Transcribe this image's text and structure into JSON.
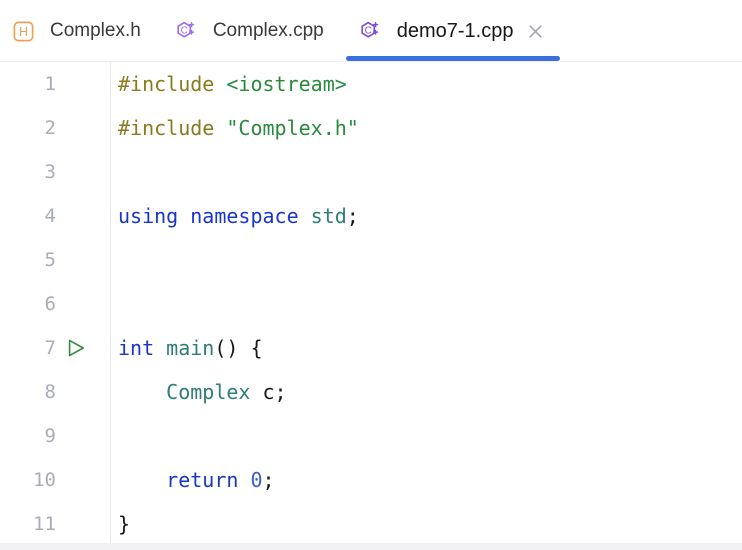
{
  "window": {
    "background_color": "#ffffff"
  },
  "tabbar": {
    "tabs": [
      {
        "label": "Complex.h",
        "icon": "cpp-header-file-icon",
        "icon_color": "#e8a25a",
        "active": false,
        "closable": false
      },
      {
        "label": "Complex.cpp",
        "icon": "cpp-source-file-icon",
        "icon_color": "#9b72e8",
        "active": false,
        "closable": false
      },
      {
        "label": "demo7-1.cpp",
        "icon": "cpp-source-file-icon",
        "icon_color": "#7b4de0",
        "active": true,
        "closable": true,
        "close_label": "×",
        "underline_color": "#3b6fe0"
      }
    ]
  },
  "editor": {
    "gutter": {
      "line_numbers": [
        "1",
        "2",
        "3",
        "4",
        "5",
        "6",
        "7",
        "8",
        "9",
        "10",
        "11"
      ],
      "run_marker": {
        "on_line": "7",
        "icon": "run-play-icon",
        "color": "#3f8a3f"
      }
    },
    "lines": [
      {
        "number": "1",
        "tokens": [
          {
            "text": "#include",
            "kind": "preprocessor"
          },
          {
            "text": " ",
            "kind": "plain"
          },
          {
            "text": "<iostream>",
            "kind": "string"
          }
        ]
      },
      {
        "number": "2",
        "tokens": [
          {
            "text": "#include",
            "kind": "preprocessor"
          },
          {
            "text": " ",
            "kind": "plain"
          },
          {
            "text": "\"Complex.h\"",
            "kind": "string"
          }
        ]
      },
      {
        "number": "3",
        "tokens": []
      },
      {
        "number": "4",
        "tokens": [
          {
            "text": "using namespace",
            "kind": "keyword"
          },
          {
            "text": " ",
            "kind": "plain"
          },
          {
            "text": "std",
            "kind": "type"
          },
          {
            "text": ";",
            "kind": "plain"
          }
        ]
      },
      {
        "number": "5",
        "tokens": []
      },
      {
        "number": "6",
        "tokens": []
      },
      {
        "number": "7",
        "tokens": [
          {
            "text": "int",
            "kind": "keyword"
          },
          {
            "text": " ",
            "kind": "plain"
          },
          {
            "text": "main",
            "kind": "type"
          },
          {
            "text": "() {",
            "kind": "plain"
          }
        ]
      },
      {
        "number": "8",
        "tokens": [
          {
            "text": "    ",
            "kind": "plain"
          },
          {
            "text": "Complex",
            "kind": "type"
          },
          {
            "text": " c;",
            "kind": "plain"
          }
        ]
      },
      {
        "number": "9",
        "tokens": []
      },
      {
        "number": "10",
        "tokens": [
          {
            "text": "    ",
            "kind": "plain"
          },
          {
            "text": "return",
            "kind": "keyword"
          },
          {
            "text": " ",
            "kind": "plain"
          },
          {
            "text": "0",
            "kind": "number"
          },
          {
            "text": ";",
            "kind": "plain"
          }
        ]
      },
      {
        "number": "11",
        "tokens": [
          {
            "text": "}",
            "kind": "plain"
          }
        ]
      }
    ],
    "syntax_colors": {
      "preprocessor": "#8a7a1e",
      "string": "#2a8a3e",
      "keyword": "#1a36c8",
      "type": "#2e7d77",
      "number": "#3b5bdb",
      "plain": "#17171a",
      "line_number": "#a9adb8"
    }
  }
}
